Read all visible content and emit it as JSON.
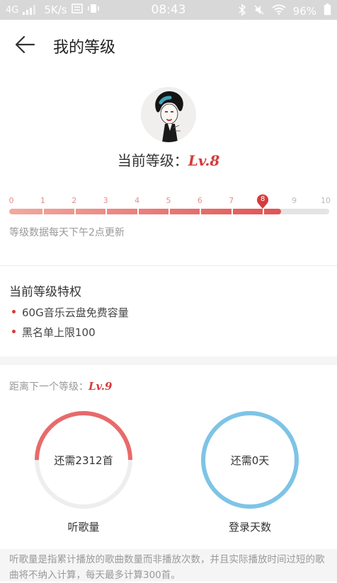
{
  "status_bar": {
    "network": "4G",
    "speed": "5K/s",
    "time": "08:43",
    "battery": "96%"
  },
  "header": {
    "title": "我的等级"
  },
  "level": {
    "label": "当前等级：",
    "value": "Lv.8",
    "ticks": [
      "0",
      "1",
      "2",
      "3",
      "4",
      "5",
      "6",
      "7",
      "8",
      "9",
      "10"
    ],
    "current_index": 8,
    "progress_fraction": 0.85,
    "update_note": "等级数据每天下午2点更新"
  },
  "privileges": {
    "title": "当前等级特权",
    "items": [
      "60G音乐云盘免费容量",
      "黑名单上限100"
    ]
  },
  "next_level": {
    "label": "距离下一个等级：",
    "value": "Lv.9",
    "rings": [
      {
        "text": "还需2312首",
        "caption": "听歌量",
        "progress_fraction": 0.5,
        "color": "#e86a6a"
      },
      {
        "text": "还需0天",
        "caption": "登录天数",
        "progress_fraction": 1.0,
        "color": "#7ec4e6"
      }
    ]
  },
  "footnote": "听歌量是指累计播放的歌曲数量而非播放次数，并且实际播放时间过短的歌曲将不纳入计算，每天最多计算300首。",
  "colors": {
    "accent": "#d63b3b",
    "listen_ring": "#e86a6a",
    "login_ring": "#7ec4e6",
    "ring_track": "#eeeeee"
  }
}
